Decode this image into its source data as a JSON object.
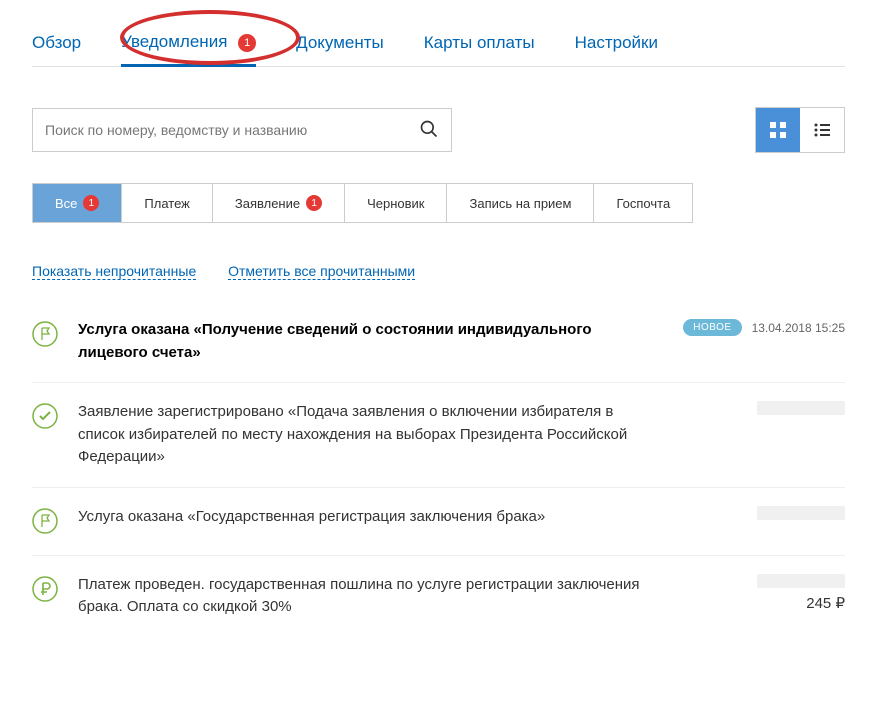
{
  "tabs": {
    "overview": "Обзор",
    "notifications": "Уведомления",
    "notifications_badge": "1",
    "documents": "Документы",
    "payment_cards": "Карты оплаты",
    "settings": "Настройки"
  },
  "search": {
    "placeholder": "Поиск по номеру, ведомству и названию"
  },
  "filters": {
    "all": "Все",
    "all_badge": "1",
    "payment": "Платеж",
    "application": "Заявление",
    "application_badge": "1",
    "draft": "Черновик",
    "appointment": "Запись на прием",
    "gospochta": "Госпочта"
  },
  "actions": {
    "show_unread": "Показать непрочитанные",
    "mark_all_read": "Отметить все прочитанными"
  },
  "badge_new": "НОВОЕ",
  "notifications": [
    {
      "icon": "flag",
      "title": "Услуга оказана «Получение сведений о состоянии индивидуального лицевого счета»",
      "bold": true,
      "is_new": true,
      "timestamp": "13.04.2018 15:25"
    },
    {
      "icon": "check",
      "title": "Заявление зарегистрировано «Подача заявления о включении избирателя в список избирателей по месту нахождения на выборах Президента Российской Федерации»"
    },
    {
      "icon": "flag",
      "title": "Услуга оказана «Государственная регистрация заключения брака»"
    },
    {
      "icon": "ruble",
      "title": "Платеж проведен. государственная пошлина по услуге регистрации заключения брака. Оплата со скидкой 30%",
      "amount": "245 ₽"
    }
  ]
}
